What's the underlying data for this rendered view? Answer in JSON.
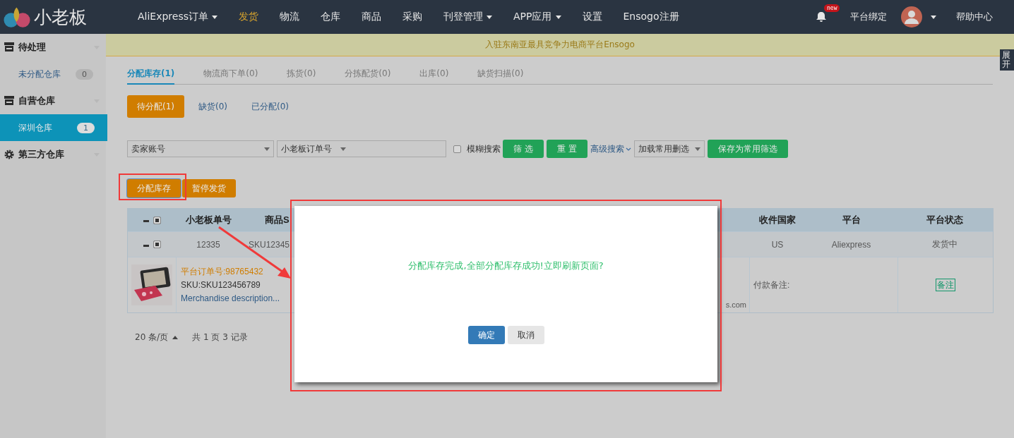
{
  "logo": {
    "text": "小老板"
  },
  "nav": [
    {
      "label": "AliExpress订单",
      "dropdown": true,
      "selected": false
    },
    {
      "label": "发货",
      "dropdown": false,
      "selected": true
    },
    {
      "label": "物流",
      "dropdown": false,
      "selected": false
    },
    {
      "label": "仓库",
      "dropdown": false,
      "selected": false
    },
    {
      "label": "商品",
      "dropdown": false,
      "selected": false
    },
    {
      "label": "采购",
      "dropdown": false,
      "selected": false
    },
    {
      "label": "刊登管理",
      "dropdown": true,
      "selected": false
    },
    {
      "label": "APP应用",
      "dropdown": true,
      "selected": false
    },
    {
      "label": "设置",
      "dropdown": false,
      "selected": false
    },
    {
      "label": "Ensogo注册",
      "dropdown": false,
      "selected": false
    }
  ],
  "header_right": {
    "notification_badge": "new",
    "bind_label": "平台绑定",
    "help": "帮助中心"
  },
  "sidebar": [
    {
      "label": "待处理",
      "children": [
        {
          "label": "未分配仓库",
          "count": "0",
          "selected": false
        }
      ]
    },
    {
      "label": "自营仓库",
      "children": [
        {
          "label": "深圳仓库",
          "count": "1",
          "selected": true
        }
      ]
    },
    {
      "label": "第三方仓库"
    }
  ],
  "banner": "入驻东南亚最具竞争力电商平台Ensogo",
  "expand_tab": "展开",
  "tabs": [
    {
      "label": "分配库存(1)",
      "selected": true
    },
    {
      "label": "物流商下单(0)",
      "selected": false
    },
    {
      "label": "拣货(0)",
      "selected": false
    },
    {
      "label": "分拣配货(0)",
      "selected": false
    },
    {
      "label": "出库(0)",
      "selected": false
    },
    {
      "label": "缺货扫描(0)",
      "selected": false
    }
  ],
  "subtabs": [
    {
      "label": "待分配(1)",
      "selected": true
    },
    {
      "label": "缺货(0)",
      "selected": false
    },
    {
      "label": "已分配(0)",
      "selected": false
    }
  ],
  "filters": {
    "seller_select": "卖家账号",
    "order_select": "小老板订单号",
    "fuzzy": {
      "label": "模糊搜索",
      "checked": false
    },
    "filter_button": "筛 选",
    "reset_button": "重 置",
    "advanced": "高级搜索",
    "load_select": "加载常用删选",
    "save_button": "保存为常用筛选"
  },
  "actions": [
    {
      "label": "分配库存",
      "highlighted": true
    },
    {
      "label": "暂停发货",
      "highlighted": false
    }
  ],
  "table": {
    "header": {
      "checked": true,
      "order_no": "小老板单号",
      "sku": "商品S",
      "country": "收件国家",
      "platform": "平台",
      "status": "平台状态"
    },
    "order": {
      "checked": true,
      "order_no": "12335",
      "sku": "SKU12345",
      "country": "US",
      "platform": "Aliexpress",
      "status": "发货中"
    },
    "detail": {
      "platform_order": "平台订单号:98765432",
      "sku": "SKU:SKU123456789",
      "description": "Merchandise description...",
      "column_3_tail": "s.com",
      "payment_note": "付款备注:",
      "note_button": "备注"
    }
  },
  "pagination": {
    "page_size": "20 条/页",
    "summary": "共 1 页 3 记录"
  },
  "dialog": {
    "message": "分配库存完成,全部分配库存成功!立即刷新页面?",
    "buttons": [
      {
        "label": "确定",
        "kind": "primary"
      },
      {
        "label": "取消",
        "kind": "default"
      }
    ]
  }
}
